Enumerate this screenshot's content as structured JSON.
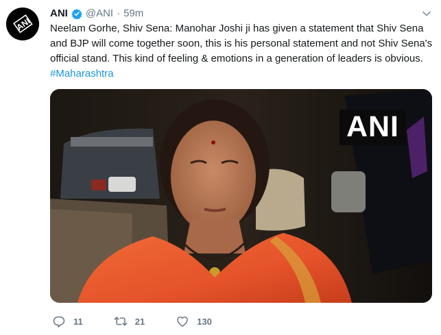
{
  "tweet": {
    "author_name": "ANI",
    "handle": "@ANI",
    "separator": "·",
    "time": "59m",
    "avatar_text": "ANI",
    "text_main": "Neelam Gorhe, Shiv Sena: Manohar Joshi ji has given a statement that Shiv Sena and BJP will come together soon, this is his personal statement and not Shiv Sena's official stand. This kind of feeling & emotions in a generation of leaders is obvious. ",
    "hashtag": "#Maharashtra",
    "media_watermark": "ANI"
  },
  "actions": {
    "reply_count": "11",
    "retweet_count": "21",
    "like_count": "130"
  },
  "icons": {
    "verified": "verified-badge-icon",
    "caret": "chevron-down-icon",
    "reply": "reply-icon",
    "retweet": "retweet-icon",
    "like": "heart-icon"
  },
  "colors": {
    "verified_blue": "#1da1f2",
    "hashtag": "#1b95e0",
    "meta_gray": "#657786",
    "saree_orange": "#e5532a"
  }
}
